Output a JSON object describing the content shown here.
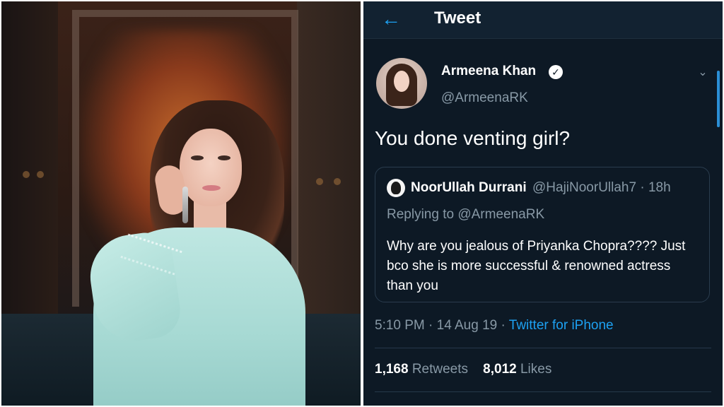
{
  "header": {
    "back_icon": "arrow-left-icon",
    "title": "Tweet"
  },
  "colors": {
    "background": "#0d1925",
    "accent": "#1da1f2",
    "muted": "#8899a6"
  },
  "tweet": {
    "author_name": "Armeena Khan",
    "author_handle": "@ArmeenaRK",
    "verified_icon": "check-icon",
    "more_icon": "chevron-down-icon",
    "text": "You done venting girl?",
    "quoted": {
      "author_name": "NoorUllah Durrani",
      "author_handle_time": "@HajiNoorUllah7 · 18h",
      "replying_to": "Replying to @ArmeenaRK",
      "body": "Why are you jealous of Priyanka Chopra???? Just bco she is more successful & renowned actress than you"
    },
    "timestamp": "5:10 PM · 14 Aug 19 · ",
    "source": "Twitter for iPhone",
    "retweets_count": "1,168",
    "retweets_label": "Retweets",
    "likes_count": "8,012",
    "likes_label": "Likes"
  }
}
